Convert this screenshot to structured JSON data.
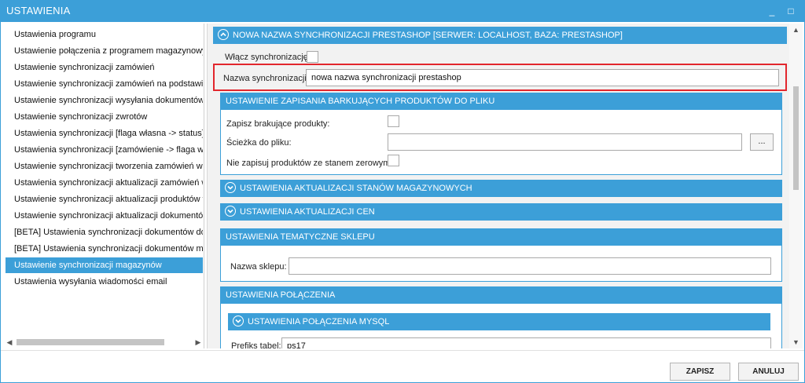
{
  "window": {
    "title": "USTAWIENIA",
    "minimize_icon": "_",
    "maximize_icon": "□"
  },
  "sidebar": {
    "items": [
      {
        "label": "Ustawienia programu"
      },
      {
        "label": "Ustawienie połączenia z programem magazynowym"
      },
      {
        "label": "Ustawienie synchronizacji zamówień"
      },
      {
        "label": "Ustawienie synchronizacji zamówień na podstawie dzi"
      },
      {
        "label": "Ustawienie synchronizacji wysyłania dokumentów"
      },
      {
        "label": "Ustawienie synchronizacji zwrotów"
      },
      {
        "label": "Ustawienia synchronizacji [flaga własna -> status]"
      },
      {
        "label": "Ustawienia synchronizacji [zamówienie -> flaga własn"
      },
      {
        "label": "Ustawienie synchronizacji tworzenia zamówień w Base"
      },
      {
        "label": "Ustawienia synchronizacji aktualizacji zamówień w Bas"
      },
      {
        "label": "Ustawienie synchronizacji aktualizacji produktów w Ba"
      },
      {
        "label": "Ustawienie synchronizacji aktualizacji dokumentów"
      },
      {
        "label": "[BETA] Ustawienia synchronizacji dokumentów dostaw"
      },
      {
        "label": "[BETA] Ustawienia synchronizacji dokumentów magaz"
      },
      {
        "label": "Ustawienie synchronizacji magazynów"
      },
      {
        "label": "Ustawienia wysyłania wiadomości email"
      }
    ],
    "active_index": 14
  },
  "main": {
    "sync_section": {
      "header": "NOWA NAZWA SYNCHRONIZACJI PRESTASHOP [SERWER: LOCALHOST, BAZA: PRESTASHOP]",
      "enable_label": "Włącz synchronizację:",
      "name_label": "Nazwa synchronizacji:",
      "name_value": "nowa nazwa synchronizacji prestashop"
    },
    "missing_products": {
      "header": "USTAWIENIE ZAPISANIA BARKUJĄCYCH PRODUKTÓW DO PLIKU",
      "save_missing_label": "Zapisz brakujące produkty:",
      "file_path_label": "Ścieżka do pliku:",
      "file_path_value": "",
      "browse_label": "...",
      "skip_zero_label": "Nie zapisuj produktów ze stanem zerowym:"
    },
    "stock_update_header": "USTAWIENIA AKTUALIZACJI STANÓW MAGAZYNOWYCH",
    "price_update_header": "USTAWIENIA AKTUALIZACJI CEN",
    "shop_theme": {
      "header": "USTAWIENIA TEMATYCZNE SKLEPU",
      "shop_name_label": "Nazwa sklepu:",
      "shop_name_value": ""
    },
    "connection": {
      "header": "USTAWIENIA POŁĄCZENIA",
      "mysql_header": "USTAWIENIA POŁĄCZENIA MYSQL",
      "prefix_label": "Prefiks tabel:",
      "prefix_value": "ps17"
    }
  },
  "footer": {
    "save_label": "ZAPISZ",
    "cancel_label": "ANULUJ"
  },
  "colors": {
    "accent": "#3c9fd8",
    "highlight": "#e2262d"
  },
  "icons": {
    "collapse": "chevron-up-icon",
    "expand": "chevron-down-icon"
  }
}
